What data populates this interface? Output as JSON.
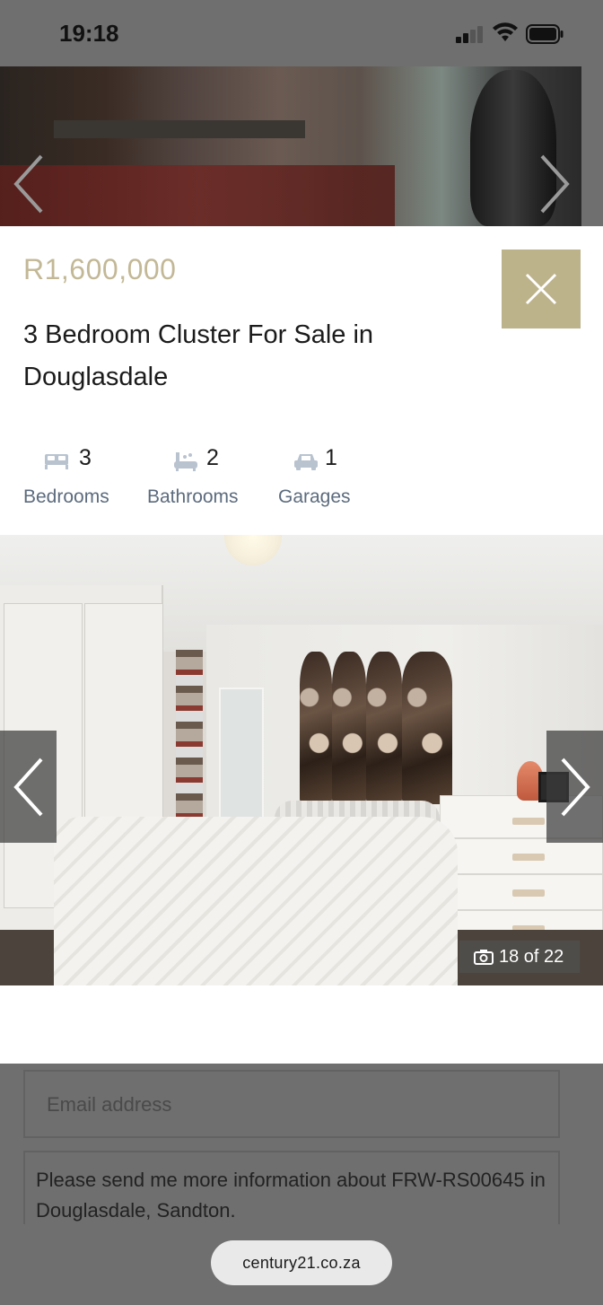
{
  "status_bar": {
    "time": "19:18"
  },
  "browser": {
    "url": "century21.co.za"
  },
  "listing": {
    "price": "R1,600,000",
    "title": "3 Bedroom Cluster For Sale in Douglasdale",
    "features": [
      {
        "icon": "bed-icon",
        "count": "3",
        "label": "Bedrooms"
      },
      {
        "icon": "bath-icon",
        "count": "2",
        "label": "Bathrooms"
      },
      {
        "icon": "car-icon",
        "count": "1",
        "label": "Garages"
      }
    ]
  },
  "gallery": {
    "counter": "18 of 22"
  },
  "form": {
    "email_placeholder": "Email address",
    "message": "Please send me more information about FRW-RS00645 in Douglasdale, Sandton."
  },
  "colors": {
    "accent": "#bdb38b",
    "price": "#c3b896",
    "feature_label": "#5c6b7e"
  }
}
